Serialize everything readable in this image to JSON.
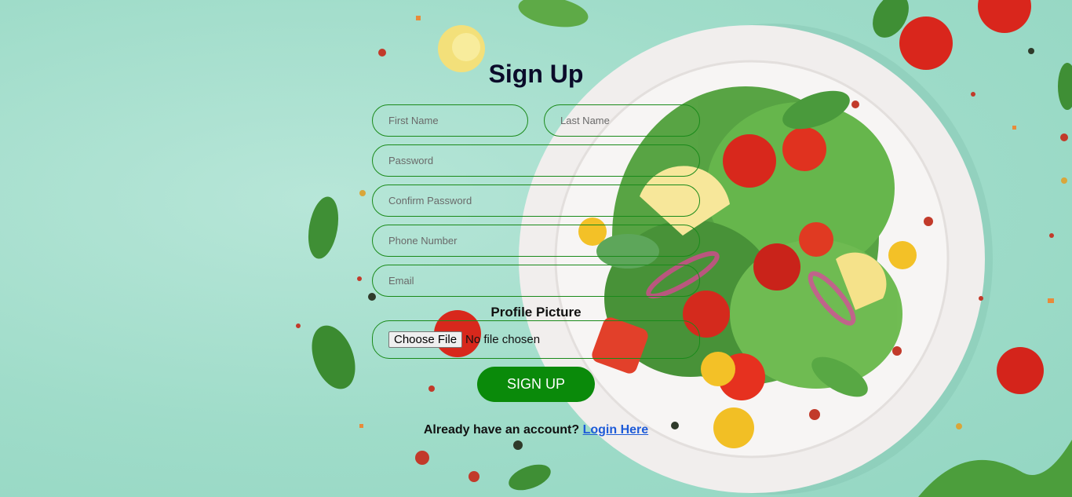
{
  "page": {
    "title": "Sign Up",
    "fields": {
      "first_name": {
        "placeholder": "First Name",
        "value": ""
      },
      "last_name": {
        "placeholder": "Last Name",
        "value": ""
      },
      "password": {
        "placeholder": "Password",
        "value": ""
      },
      "confirm_password": {
        "placeholder": "Confirm Password",
        "value": ""
      },
      "phone": {
        "placeholder": "Phone Number",
        "value": ""
      },
      "email": {
        "placeholder": "Email",
        "value": ""
      }
    },
    "profile_picture_label": "Profile Picture",
    "file_button_label": "Choose File",
    "file_status": "No file chosen",
    "submit_label": "SIGN UP",
    "login_prompt": "Already have an account?",
    "login_link": "Login Here"
  },
  "colors": {
    "accent_green": "#0a8a0a",
    "field_border": "#1a8a1a",
    "link_blue": "#1e5bd8",
    "background_mint": "#a8e0cf"
  },
  "background_image": "salad-plate-on-mint-background"
}
